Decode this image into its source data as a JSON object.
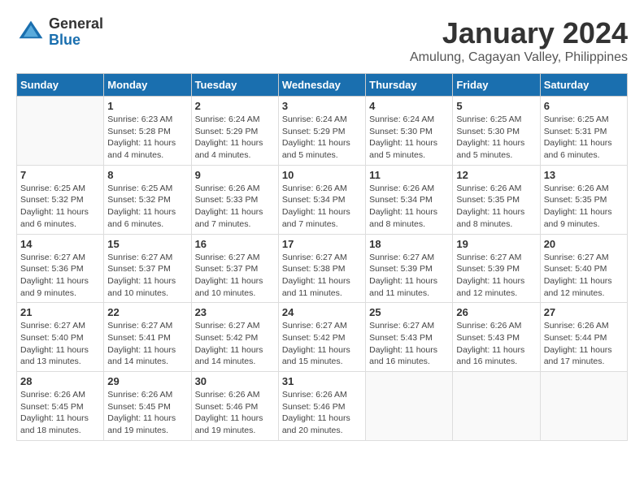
{
  "logo": {
    "general": "General",
    "blue": "Blue"
  },
  "title": "January 2024",
  "subtitle": "Amulung, Cagayan Valley, Philippines",
  "days_header": [
    "Sunday",
    "Monday",
    "Tuesday",
    "Wednesday",
    "Thursday",
    "Friday",
    "Saturday"
  ],
  "weeks": [
    [
      {
        "day": "",
        "info": ""
      },
      {
        "day": "1",
        "info": "Sunrise: 6:23 AM\nSunset: 5:28 PM\nDaylight: 11 hours\nand 4 minutes."
      },
      {
        "day": "2",
        "info": "Sunrise: 6:24 AM\nSunset: 5:29 PM\nDaylight: 11 hours\nand 4 minutes."
      },
      {
        "day": "3",
        "info": "Sunrise: 6:24 AM\nSunset: 5:29 PM\nDaylight: 11 hours\nand 5 minutes."
      },
      {
        "day": "4",
        "info": "Sunrise: 6:24 AM\nSunset: 5:30 PM\nDaylight: 11 hours\nand 5 minutes."
      },
      {
        "day": "5",
        "info": "Sunrise: 6:25 AM\nSunset: 5:30 PM\nDaylight: 11 hours\nand 5 minutes."
      },
      {
        "day": "6",
        "info": "Sunrise: 6:25 AM\nSunset: 5:31 PM\nDaylight: 11 hours\nand 6 minutes."
      }
    ],
    [
      {
        "day": "7",
        "info": "Sunrise: 6:25 AM\nSunset: 5:32 PM\nDaylight: 11 hours\nand 6 minutes."
      },
      {
        "day": "8",
        "info": "Sunrise: 6:25 AM\nSunset: 5:32 PM\nDaylight: 11 hours\nand 6 minutes."
      },
      {
        "day": "9",
        "info": "Sunrise: 6:26 AM\nSunset: 5:33 PM\nDaylight: 11 hours\nand 7 minutes."
      },
      {
        "day": "10",
        "info": "Sunrise: 6:26 AM\nSunset: 5:34 PM\nDaylight: 11 hours\nand 7 minutes."
      },
      {
        "day": "11",
        "info": "Sunrise: 6:26 AM\nSunset: 5:34 PM\nDaylight: 11 hours\nand 8 minutes."
      },
      {
        "day": "12",
        "info": "Sunrise: 6:26 AM\nSunset: 5:35 PM\nDaylight: 11 hours\nand 8 minutes."
      },
      {
        "day": "13",
        "info": "Sunrise: 6:26 AM\nSunset: 5:35 PM\nDaylight: 11 hours\nand 9 minutes."
      }
    ],
    [
      {
        "day": "14",
        "info": "Sunrise: 6:27 AM\nSunset: 5:36 PM\nDaylight: 11 hours\nand 9 minutes."
      },
      {
        "day": "15",
        "info": "Sunrise: 6:27 AM\nSunset: 5:37 PM\nDaylight: 11 hours\nand 10 minutes."
      },
      {
        "day": "16",
        "info": "Sunrise: 6:27 AM\nSunset: 5:37 PM\nDaylight: 11 hours\nand 10 minutes."
      },
      {
        "day": "17",
        "info": "Sunrise: 6:27 AM\nSunset: 5:38 PM\nDaylight: 11 hours\nand 11 minutes."
      },
      {
        "day": "18",
        "info": "Sunrise: 6:27 AM\nSunset: 5:39 PM\nDaylight: 11 hours\nand 11 minutes."
      },
      {
        "day": "19",
        "info": "Sunrise: 6:27 AM\nSunset: 5:39 PM\nDaylight: 11 hours\nand 12 minutes."
      },
      {
        "day": "20",
        "info": "Sunrise: 6:27 AM\nSunset: 5:40 PM\nDaylight: 11 hours\nand 12 minutes."
      }
    ],
    [
      {
        "day": "21",
        "info": "Sunrise: 6:27 AM\nSunset: 5:40 PM\nDaylight: 11 hours\nand 13 minutes."
      },
      {
        "day": "22",
        "info": "Sunrise: 6:27 AM\nSunset: 5:41 PM\nDaylight: 11 hours\nand 14 minutes."
      },
      {
        "day": "23",
        "info": "Sunrise: 6:27 AM\nSunset: 5:42 PM\nDaylight: 11 hours\nand 14 minutes."
      },
      {
        "day": "24",
        "info": "Sunrise: 6:27 AM\nSunset: 5:42 PM\nDaylight: 11 hours\nand 15 minutes."
      },
      {
        "day": "25",
        "info": "Sunrise: 6:27 AM\nSunset: 5:43 PM\nDaylight: 11 hours\nand 16 minutes."
      },
      {
        "day": "26",
        "info": "Sunrise: 6:26 AM\nSunset: 5:43 PM\nDaylight: 11 hours\nand 16 minutes."
      },
      {
        "day": "27",
        "info": "Sunrise: 6:26 AM\nSunset: 5:44 PM\nDaylight: 11 hours\nand 17 minutes."
      }
    ],
    [
      {
        "day": "28",
        "info": "Sunrise: 6:26 AM\nSunset: 5:45 PM\nDaylight: 11 hours\nand 18 minutes."
      },
      {
        "day": "29",
        "info": "Sunrise: 6:26 AM\nSunset: 5:45 PM\nDaylight: 11 hours\nand 19 minutes."
      },
      {
        "day": "30",
        "info": "Sunrise: 6:26 AM\nSunset: 5:46 PM\nDaylight: 11 hours\nand 19 minutes."
      },
      {
        "day": "31",
        "info": "Sunrise: 6:26 AM\nSunset: 5:46 PM\nDaylight: 11 hours\nand 20 minutes."
      },
      {
        "day": "",
        "info": ""
      },
      {
        "day": "",
        "info": ""
      },
      {
        "day": "",
        "info": ""
      }
    ]
  ]
}
